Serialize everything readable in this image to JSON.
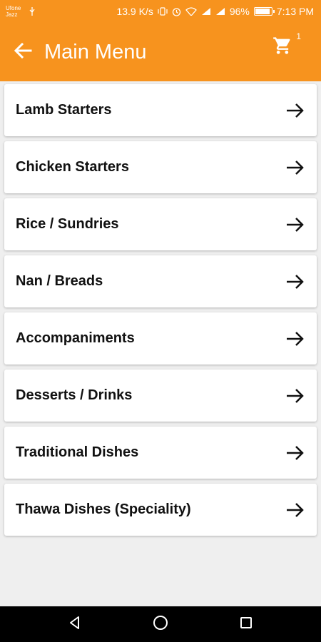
{
  "status_bar": {
    "carrier_line1": "Ufone",
    "carrier_line2": "Jazz",
    "speed": "13.9 K/s",
    "battery_percent": "96%",
    "battery_level": 0.96,
    "time": "7:13 PM"
  },
  "app_bar": {
    "title": "Main Menu",
    "back_icon": "arrow-left-icon",
    "cart_icon": "cart-icon",
    "cart_count": "1"
  },
  "menu": {
    "items": [
      {
        "label": "Lamb Starters"
      },
      {
        "label": "Chicken Starters"
      },
      {
        "label": "Rice / Sundries"
      },
      {
        "label": "Nan / Breads"
      },
      {
        "label": "Accompaniments"
      },
      {
        "label": "Desserts / Drinks"
      },
      {
        "label": "Traditional Dishes"
      },
      {
        "label": "Thawa Dishes (Speciality)"
      }
    ]
  },
  "nav_bar": {
    "back": "triangle-back-icon",
    "home": "circle-home-icon",
    "recents": "square-recents-icon"
  },
  "colors": {
    "accent": "#f7931e",
    "card": "#ffffff",
    "background": "#efefef"
  }
}
